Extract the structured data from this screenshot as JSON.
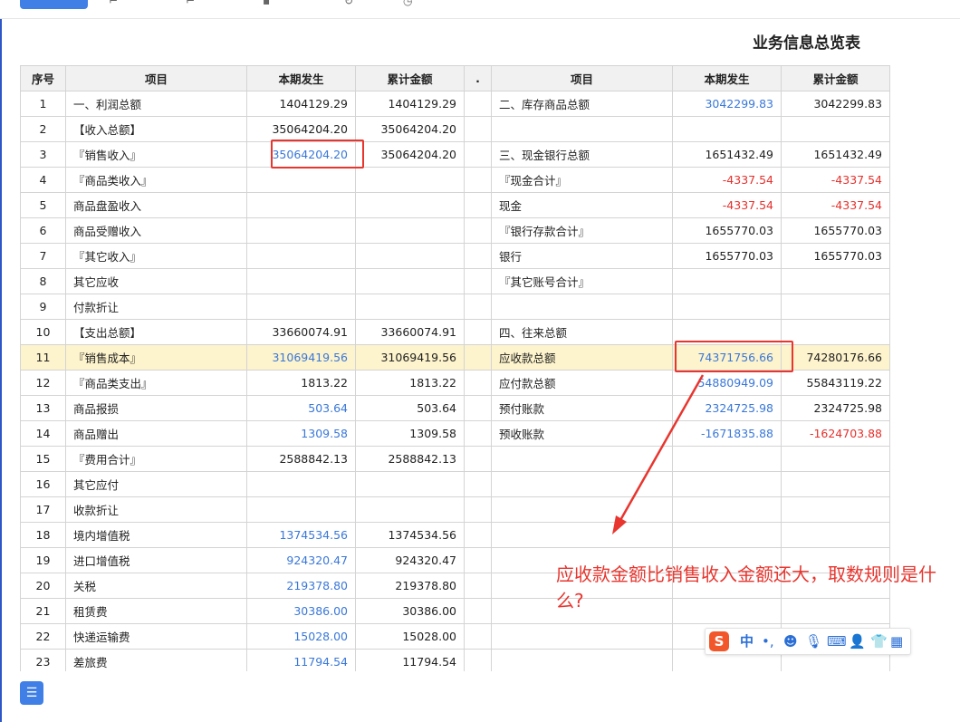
{
  "report": {
    "title": "业务信息总览表",
    "headers": [
      "序号",
      "项目",
      "本期发生",
      "累计金额",
      ".",
      "项目",
      "本期发生",
      "累计金额"
    ],
    "rows": [
      {
        "idx": "1",
        "left": {
          "name": "一、利润总额",
          "cur": "1404129.29",
          "cum": "1404129.29"
        },
        "right": {
          "name": "二、库存商品总额",
          "cur": "3042299.83",
          "cum": "3042299.83"
        }
      },
      {
        "idx": "2",
        "left": {
          "name": "【收入总额】",
          "cur": "35064204.20",
          "cum": "35064204.20"
        },
        "right": {
          "name": "",
          "cur": "",
          "cum": ""
        }
      },
      {
        "idx": "3",
        "left": {
          "name": "『销售收入』",
          "cur": "35064204.20",
          "cum": "35064204.20"
        },
        "right": {
          "name": "三、现金银行总额",
          "cur": "1651432.49",
          "cum": "1651432.49"
        }
      },
      {
        "idx": "4",
        "left": {
          "name": "『商品类收入』",
          "cur": "",
          "cum": ""
        },
        "right": {
          "name": "『现金合计』",
          "cur": "-4337.54",
          "cum": "-4337.54"
        }
      },
      {
        "idx": "5",
        "left": {
          "name": "商品盘盈收入",
          "cur": "",
          "cum": ""
        },
        "right": {
          "name": "现金",
          "cur": "-4337.54",
          "cum": "-4337.54"
        }
      },
      {
        "idx": "6",
        "left": {
          "name": "商品受赠收入",
          "cur": "",
          "cum": ""
        },
        "right": {
          "name": "『银行存款合计』",
          "cur": "1655770.03",
          "cum": "1655770.03"
        }
      },
      {
        "idx": "7",
        "left": {
          "name": "『其它收入』",
          "cur": "",
          "cum": ""
        },
        "right": {
          "name": "银行",
          "cur": "1655770.03",
          "cum": "1655770.03"
        }
      },
      {
        "idx": "8",
        "left": {
          "name": "其它应收",
          "cur": "",
          "cum": ""
        },
        "right": {
          "name": "『其它账号合计』",
          "cur": "",
          "cum": ""
        }
      },
      {
        "idx": "9",
        "left": {
          "name": "付款折让",
          "cur": "",
          "cum": ""
        },
        "right": {
          "name": "",
          "cur": "",
          "cum": ""
        }
      },
      {
        "idx": "10",
        "left": {
          "name": "【支出总额】",
          "cur": "33660074.91",
          "cum": "33660074.91"
        },
        "right": {
          "name": "四、往来总额",
          "cur": "",
          "cum": ""
        }
      },
      {
        "idx": "11",
        "left": {
          "name": "『销售成本』",
          "cur": "31069419.56",
          "cum": "31069419.56"
        },
        "right": {
          "name": "应收款总额",
          "cur": "74371756.66",
          "cum": "74280176.66"
        }
      },
      {
        "idx": "12",
        "left": {
          "name": "『商品类支出』",
          "cur": "1813.22",
          "cum": "1813.22"
        },
        "right": {
          "name": "应付款总额",
          "cur": "54880949.09",
          "cum": "55843119.22"
        }
      },
      {
        "idx": "13",
        "left": {
          "name": "商品报损",
          "cur": "503.64",
          "cum": "503.64"
        },
        "right": {
          "name": "预付账款",
          "cur": "2324725.98",
          "cum": "2324725.98"
        }
      },
      {
        "idx": "14",
        "left": {
          "name": "商品赠出",
          "cur": "1309.58",
          "cum": "1309.58"
        },
        "right": {
          "name": "预收账款",
          "cur": "-1671835.88",
          "cum": "-1624703.88"
        }
      },
      {
        "idx": "15",
        "left": {
          "name": "『费用合计』",
          "cur": "2588842.13",
          "cum": "2588842.13"
        },
        "right": {
          "name": "",
          "cur": "",
          "cum": ""
        }
      },
      {
        "idx": "16",
        "left": {
          "name": "其它应付",
          "cur": "",
          "cum": ""
        },
        "right": {
          "name": "",
          "cur": "",
          "cum": ""
        }
      },
      {
        "idx": "17",
        "left": {
          "name": "收款折让",
          "cur": "",
          "cum": ""
        },
        "right": {
          "name": "",
          "cur": "",
          "cum": ""
        }
      },
      {
        "idx": "18",
        "left": {
          "name": "境内增值税",
          "cur": "1374534.56",
          "cum": "1374534.56"
        },
        "right": {
          "name": "",
          "cur": "",
          "cum": ""
        }
      },
      {
        "idx": "19",
        "left": {
          "name": "进口增值税",
          "cur": "924320.47",
          "cum": "924320.47"
        },
        "right": {
          "name": "",
          "cur": "",
          "cum": ""
        }
      },
      {
        "idx": "20",
        "left": {
          "name": "关税",
          "cur": "219378.80",
          "cum": "219378.80"
        },
        "right": {
          "name": "",
          "cur": "",
          "cum": ""
        }
      },
      {
        "idx": "21",
        "left": {
          "name": "租赁费",
          "cur": "30386.00",
          "cum": "30386.00"
        },
        "right": {
          "name": "",
          "cur": "",
          "cum": ""
        }
      },
      {
        "idx": "22",
        "left": {
          "name": "快递运输费",
          "cur": "15028.00",
          "cum": "15028.00"
        },
        "right": {
          "name": "",
          "cur": "",
          "cum": ""
        }
      },
      {
        "idx": "23",
        "left": {
          "name": "差旅费",
          "cur": "11794.54",
          "cum": "11794.54"
        },
        "right": {
          "name": "",
          "cur": "",
          "cum": ""
        }
      }
    ]
  },
  "cell_styles": {
    "blue_cells": [
      "1.right.cur",
      "3.left.cur",
      "11.left.cur",
      "11.right.cur",
      "12.right.cur",
      "13.left.cur",
      "13.right.cur",
      "14.left.cur",
      "14.right.cur",
      "18.left.cur",
      "19.left.cur",
      "20.left.cur",
      "21.left.cur",
      "22.left.cur",
      "23.left.cur"
    ],
    "red_cells": [
      "4.right.cur",
      "4.right.cum",
      "5.right.cur",
      "5.right.cum",
      "14.right.cum"
    ],
    "highlight_row": "11"
  },
  "annotation": {
    "text": "应收款金额比销售收入金额还大，取数规则是什么?",
    "color": "#e8352e"
  },
  "ime": {
    "logo": "S",
    "mode": "中",
    "punct": "•,"
  },
  "colors": {
    "accent": "#3f7fe6",
    "link": "#3a78d8",
    "negative": "#e4302b",
    "highlight": "#fdf3cc",
    "annotation": "#e8352e"
  }
}
